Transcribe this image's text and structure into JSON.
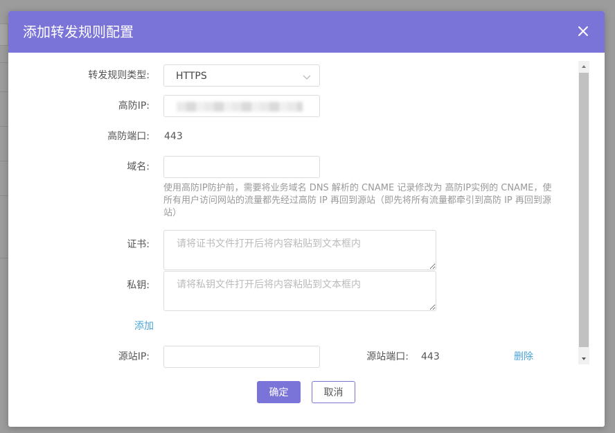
{
  "dialog": {
    "title": "添加转发规则配置",
    "close_icon": "close-icon",
    "accent_color": "#7b74d8"
  },
  "form": {
    "rule_type": {
      "label": "转发规则类型:",
      "value": "HTTPS"
    },
    "defense_ip": {
      "label": "高防IP:",
      "value_obscured": true
    },
    "defense_port": {
      "label": "高防端口:",
      "value": "443"
    },
    "domain": {
      "label": "域名:",
      "value": "",
      "hint": "使用高防IP防护前，需要将业务域名 DNS 解析的 CNAME 记录修改为 高防IP实例的 CNAME，使所有用户访问网站的流量都先经过高防 IP 再回到源站（即先将所有流量都牵引到高防 IP 再回到源站）"
    },
    "certificate": {
      "label": "证书:",
      "placeholder": "请将证书文件打开后将内容粘贴到文本框内"
    },
    "private_key": {
      "label": "私钥:",
      "placeholder": "请将私钥文件打开后将内容粘贴到文本框内"
    },
    "add_link": "添加",
    "origin_ip": {
      "label": "源站IP:",
      "value": ""
    },
    "origin_port": {
      "label": "源站端口:",
      "value": "443"
    },
    "delete_link": "删除"
  },
  "footer": {
    "confirm_label": "确定",
    "cancel_label": "取消"
  }
}
